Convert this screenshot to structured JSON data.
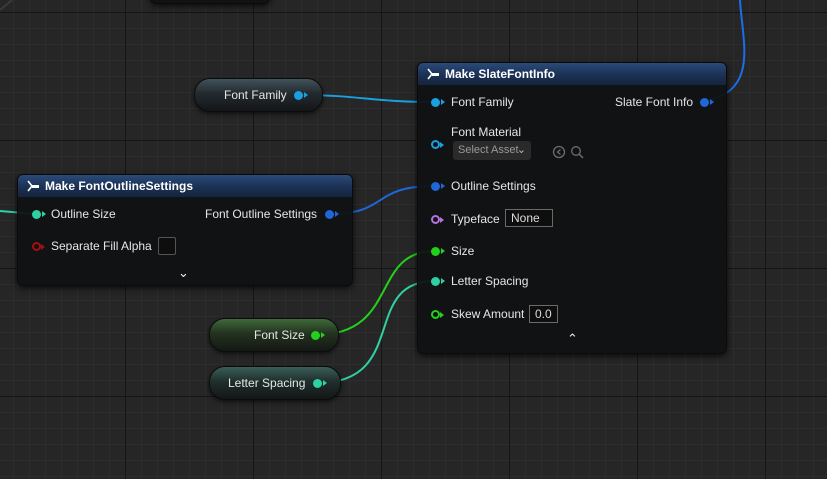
{
  "nodes": {
    "make_slate_font_info": {
      "title": "Make SlateFontInfo",
      "inputs": {
        "font_family": "Font Family",
        "font_material": "Font Material",
        "outline_settings": "Outline Settings",
        "typeface": "Typeface",
        "size": "Size",
        "letter_spacing": "Letter Spacing",
        "skew_amount": "Skew Amount"
      },
      "font_material_select": "Select Asset",
      "typeface_value": "None",
      "skew_amount_value": "0.0",
      "output": "Slate Font Info"
    },
    "make_font_outline_settings": {
      "title": "Make FontOutlineSettings",
      "inputs": {
        "outline_size": "Outline Size",
        "separate_fill_alpha": "Separate Fill Alpha"
      },
      "output": "Font Outline Settings"
    },
    "font_family_var": {
      "label": "Font Family"
    },
    "font_size_var": {
      "label": "Font Size"
    },
    "letter_spacing_var": {
      "label": "Letter Spacing"
    }
  },
  "pin_colors": {
    "struct": "#1f66d6",
    "object": "#1a9fe0",
    "float": "#2ed1a4",
    "integer": "#23d11c",
    "bool": "#a31010",
    "name": "#b673e0"
  }
}
